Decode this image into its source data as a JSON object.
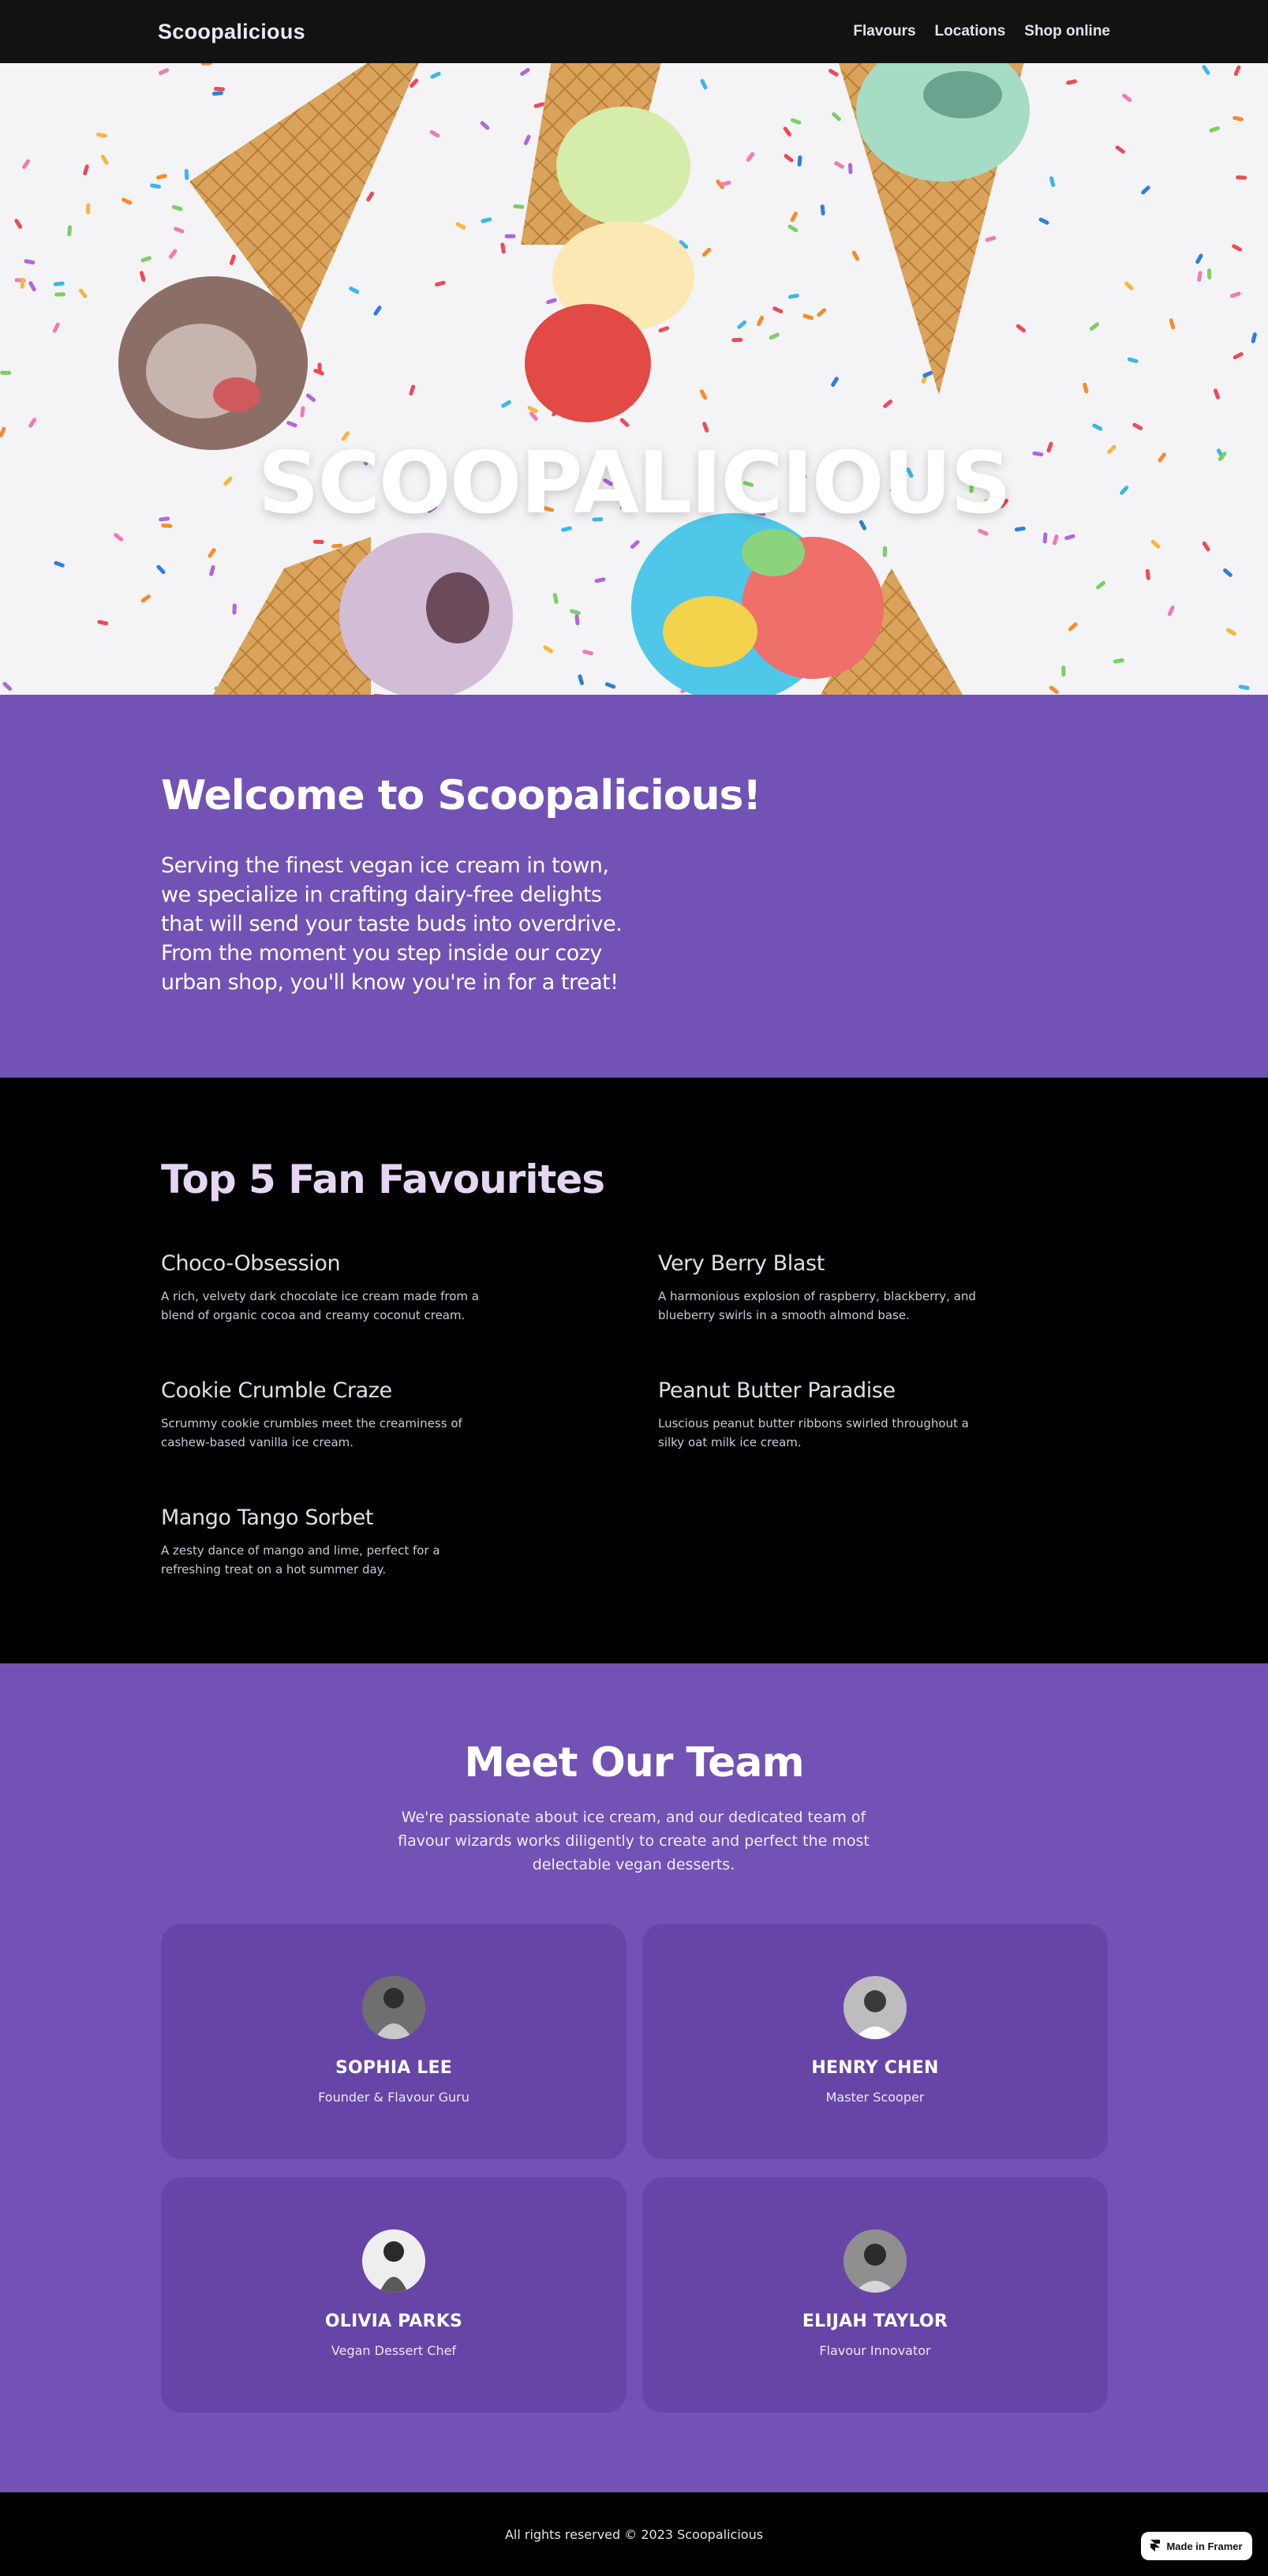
{
  "nav": {
    "brand": "Scoopalicious",
    "links": [
      "Flavours",
      "Locations",
      "Shop online"
    ]
  },
  "hero": {
    "title": "SCOOPALICIOUS"
  },
  "welcome": {
    "heading": "Welcome to Scoopalicious!",
    "body": "Serving the finest vegan ice cream in town, we specialize in crafting dairy-free delights that will send your taste buds into overdrive. From the moment you step inside our cozy urban shop, you'll know you're in for a treat!"
  },
  "favourites": {
    "heading": "Top 5 Fan Favourites",
    "items": [
      {
        "name": "Choco-Obsession",
        "desc": "A rich, velvety dark chocolate ice cream made from a blend of organic cocoa and creamy coconut cream."
      },
      {
        "name": "Very Berry Blast",
        "desc": "A harmonious explosion of raspberry, blackberry, and blueberry swirls in a smooth almond base."
      },
      {
        "name": "Cookie Crumble Craze",
        "desc": "Scrummy cookie crumbles meet the creaminess of cashew-based vanilla ice cream."
      },
      {
        "name": "Peanut Butter Paradise",
        "desc": "Luscious peanut butter ribbons swirled throughout a silky oat milk ice cream."
      },
      {
        "name": "Mango Tango Sorbet",
        "desc": "A zesty dance of mango and lime, perfect for a refreshing treat on a hot summer day."
      }
    ]
  },
  "team": {
    "heading": "Meet Our Team",
    "intro": "We're passionate about ice cream, and our dedicated team of flavour wizards works diligently to create and perfect the most delectable vegan desserts.",
    "members": [
      {
        "name": "SOPHIA LEE",
        "role": "Founder & Flavour Guru"
      },
      {
        "name": "HENRY CHEN",
        "role": "Master Scooper"
      },
      {
        "name": "OLIVIA PARKS",
        "role": "Vegan Dessert Chef"
      },
      {
        "name": "ELIJAH TAYLOR",
        "role": "Flavour Innovator"
      }
    ]
  },
  "footer": {
    "copyright": "All rights reserved © 2023 Scoopalicious",
    "badge": "Made in Framer"
  },
  "colors": {
    "nav_bg": "#121212",
    "purple": "#7252b4",
    "card": "#6645a6",
    "black": "#000000"
  }
}
